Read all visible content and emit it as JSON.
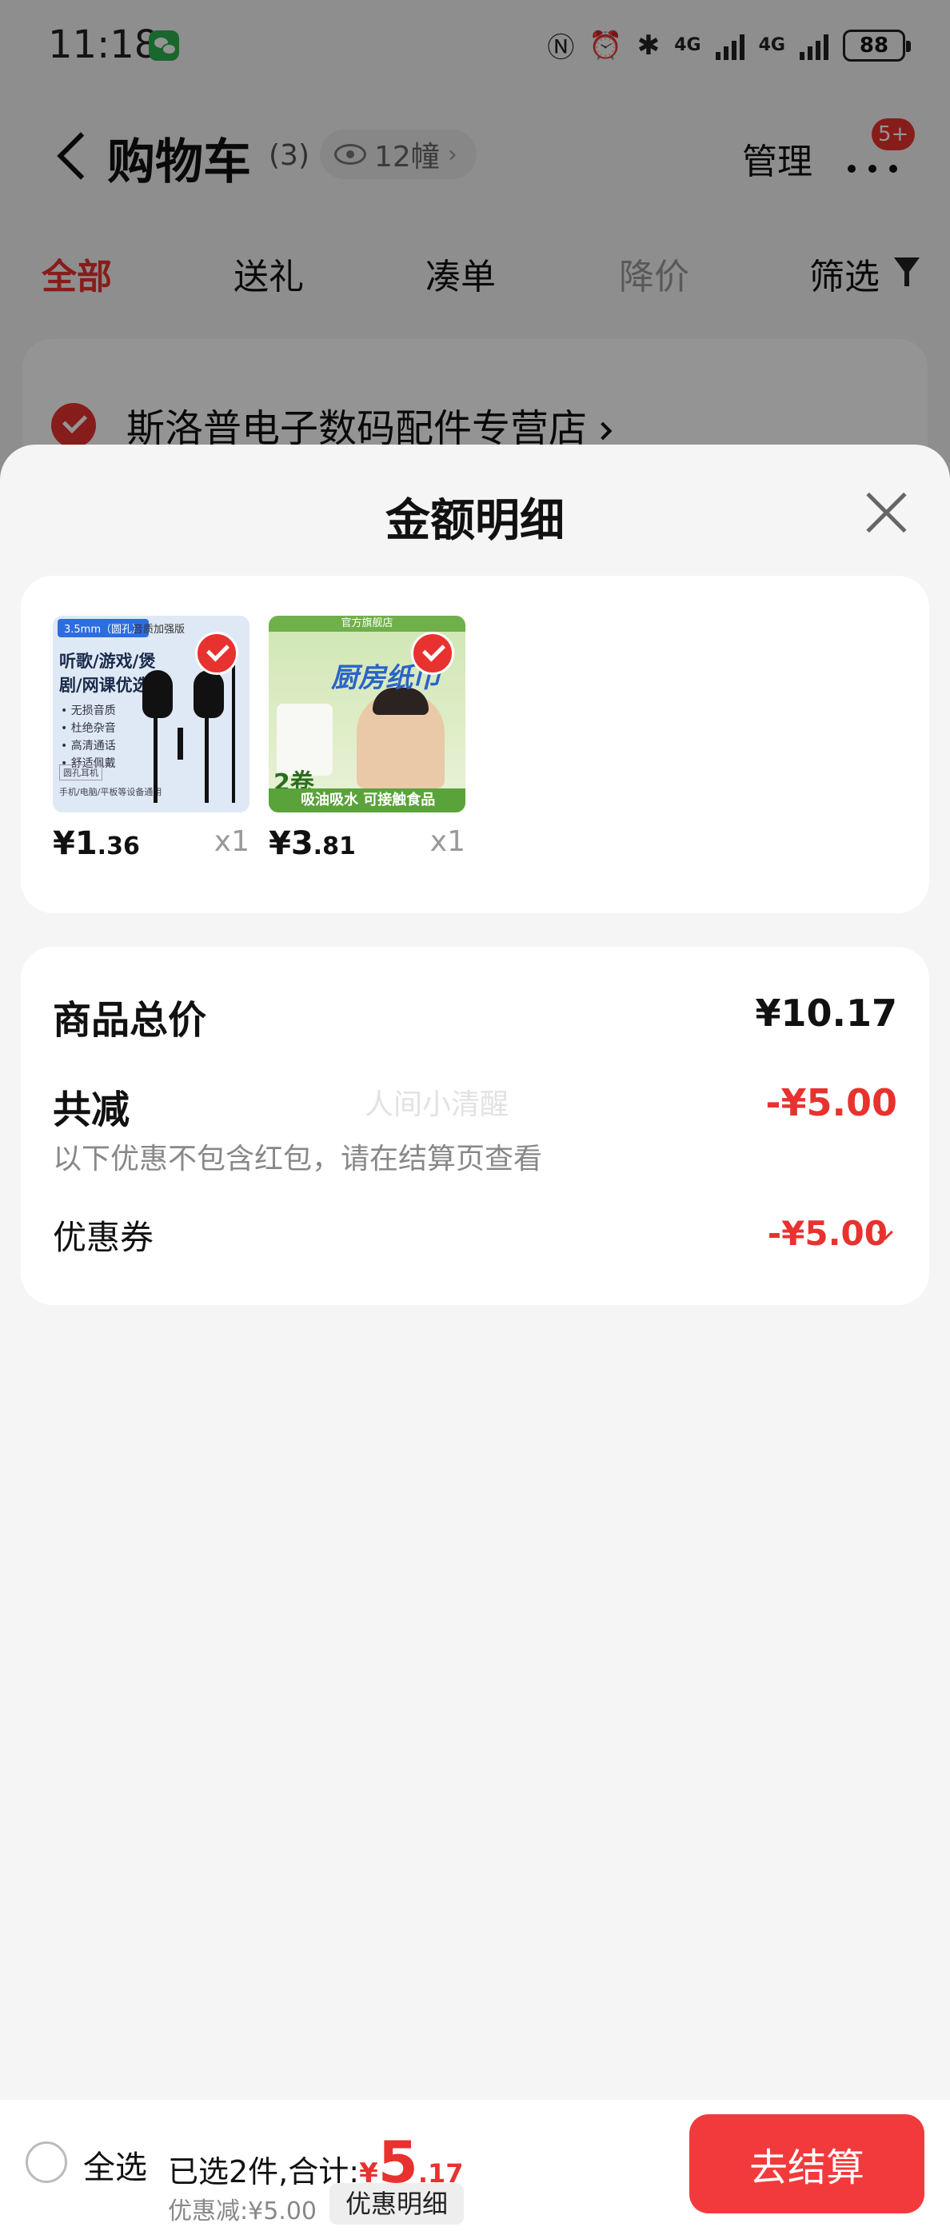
{
  "status_bar": {
    "time": "11:18",
    "network_1": "4G",
    "network_2": "4G",
    "battery": "88"
  },
  "header": {
    "title": "购物车",
    "count": "(3)",
    "views": "12幢",
    "manage_label": "管理",
    "badge": "5+"
  },
  "tabs": [
    {
      "label": "全部",
      "state": "active"
    },
    {
      "label": "送礼"
    },
    {
      "label": "凑单"
    },
    {
      "label": "降价",
      "state": "disabled"
    },
    {
      "label": "筛选"
    }
  ],
  "store": {
    "name": "斯洛普电子数码配件专营店"
  },
  "sheet": {
    "title": "金额明细",
    "items": [
      {
        "price_int": "¥1",
        "price_dec": ".36",
        "qty": "x1",
        "image_text": {
          "tag": "3.5mm（圆孔）",
          "tag_sub": "音质加强版",
          "headline": "听歌/游戏/煲剧/网课优选",
          "bullets": [
            "• 无损音质",
            "• 杜绝杂音",
            "• 高清通话",
            "• 舒适佩戴"
          ],
          "label": "圆孔耳机",
          "foot": "手机/电脑/平板等设备通用"
        }
      },
      {
        "price_int": "¥3",
        "price_dec": ".81",
        "qty": "x1",
        "image_text": {
          "top": "官方旗舰店",
          "brand": "厨房纸巾",
          "count": "2卷",
          "bottom": "吸油吸水 可接触食品"
        }
      }
    ],
    "summary": {
      "total_label": "商品总价",
      "total_value": "¥10.17",
      "reduce_label": "共减",
      "reduce_value": "-¥5.00",
      "note": "以下优惠不包含红包，请在结算页查看",
      "coupon_label": "优惠券",
      "coupon_value": "-¥5.00",
      "watermark": "人间小清醒"
    }
  },
  "bottom_bar": {
    "select_all": "全选",
    "selected_text": "已选2件,合计:",
    "total_symbol": "¥",
    "total_int": "5",
    "total_dec": ".17",
    "discount_text": "优惠减:¥5.00",
    "detail_button": "优惠明细",
    "checkout_button": "去结算"
  },
  "colors": {
    "accent_red": "#e8322f",
    "checkout_red": "#f23a3c"
  }
}
